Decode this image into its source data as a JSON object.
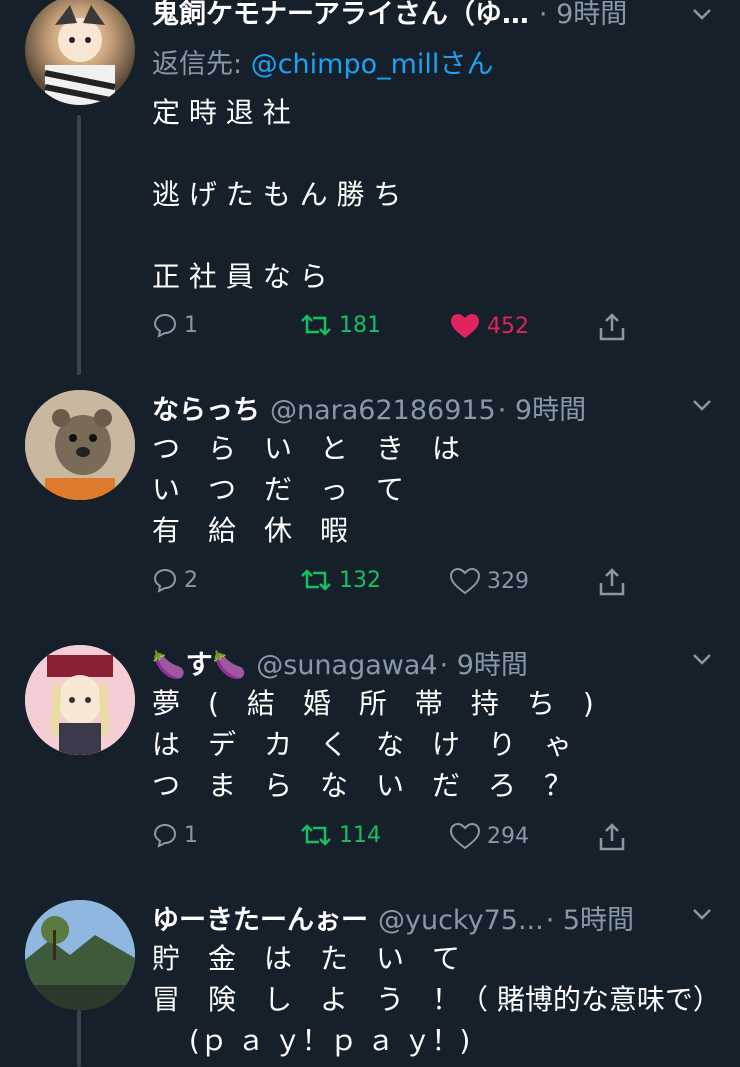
{
  "colors": {
    "background": "#15202b",
    "secondary": "#8899a6",
    "accent": "#1da1f2",
    "retweeted": "#17bf63",
    "liked": "#e0245e"
  },
  "tweets": [
    {
      "name": "鬼飼ケモナーアライさん（ゆ…",
      "handle": "",
      "time": "· 9時間",
      "reply_label": "返信先: ",
      "reply_to": "@chimpo_millさん",
      "text": "定 時 退 社\n\n逃 げ た も ん 勝 ち\n\n正 社 員 な ら",
      "replies": "1",
      "retweets": "181",
      "likes": "452",
      "retweeted": true,
      "liked": true
    },
    {
      "name": "ならっち",
      "handle": "@nara62186915",
      "time": "· 9時間",
      "text": "つ　ら　い　と　き　は\nい　つ　だ　っ　て\n有　給　休　暇",
      "replies": "2",
      "retweets": "132",
      "likes": "329",
      "retweeted": true,
      "liked": false
    },
    {
      "name": "🍆す🍆",
      "handle": "@sunagawa4",
      "time": "· 9時間",
      "text": "夢　(　結　婚　所　帯　持　ち　)\nは　デ　カ　く　な　け　り　ゃ\nつ　ま　ら　な　い　だ　ろ　？",
      "replies": "1",
      "retweets": "114",
      "likes": "294",
      "retweeted": true,
      "liked": false
    },
    {
      "name": "ゆーきたーんぉー",
      "handle": "@yucky75...",
      "time": "· 5時間",
      "text": "貯　金　は　た　い　て\n冒　険　し　よ　う　！（ 賭博的な意味で）\n　 (ｐ ａ ｙ！ｐ ａ ｙ！)"
    }
  ]
}
